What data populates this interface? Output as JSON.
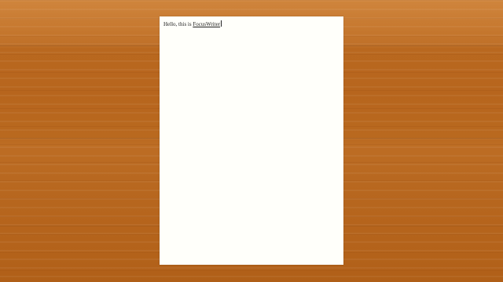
{
  "app": {
    "name": "FocusWriter"
  },
  "document": {
    "text_before_link": "Hello, this is ",
    "link_text": "FocusWriter"
  },
  "theme": {
    "background": "wood",
    "page_color": "#fffffa",
    "text_color": "#1c1c1c"
  }
}
